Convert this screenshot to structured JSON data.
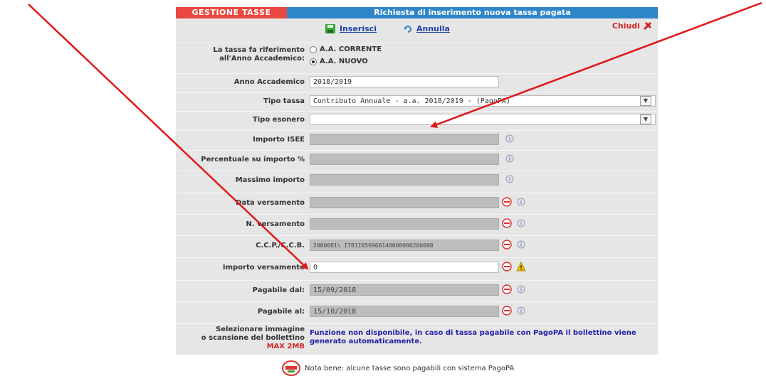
{
  "header": {
    "left_title": "GESTIONE TASSE",
    "right_title": "Richiesta di inserimento nuova tassa pagata"
  },
  "toolbar": {
    "insert_label": "Inserisci",
    "cancel_label": "Annulla",
    "close_label": "Chiudi"
  },
  "form": {
    "riferimento_label_1": "La tassa fa riferimento",
    "riferimento_label_2": "all'Anno Accademico:",
    "radio_corrente": "A.A. CORRENTE",
    "radio_nuovo": "A.A. NUOVO",
    "radio_selected": "A.A. NUOVO",
    "anno_label": "Anno Accademico",
    "anno_value": "2018/2019",
    "tipo_tassa_label": "Tipo tassa",
    "tipo_tassa_value": "Contributo Annuale - a.a. 2018/2019 - (PagoPA)",
    "tipo_esonero_label": "Tipo esonero",
    "tipo_esonero_value": "",
    "importo_isee_label": "Importo ISEE",
    "percentuale_label": "Percentuale su importo %",
    "massimo_label": "Massimo importo",
    "data_versamento_label": "Data versamento",
    "n_versamento_label": "N. versamento",
    "ccp_label": "C.C.P./C.C.B.",
    "ccp_value": "2000081\\ IT01I056960140000000200008",
    "importo_versamento_label": "Importo versamento",
    "importo_versamento_value": "0",
    "pagabile_dal_label": "Pagabile dal:",
    "pagabile_dal_value": "15/09/2018",
    "pagabile_al_label": "Pagabile al:",
    "pagabile_al_value": "15/10/2018",
    "seleziona_label_1": "Selezionare immagine",
    "seleziona_label_2": "o scansione del bollettino",
    "seleziona_label_3": "MAX 2MB",
    "notice": "Funzione non disponibile, in caso di tassa pagabile con PagoPA il bollettino viene generato automaticamente."
  },
  "footer": {
    "note": "Nota bene: alcune tasse sono pagabili con sistema PagoPA"
  },
  "colors": {
    "header_left": "#e8483f",
    "header_right": "#2e86c9",
    "annotation_arrow": "#e01818"
  }
}
